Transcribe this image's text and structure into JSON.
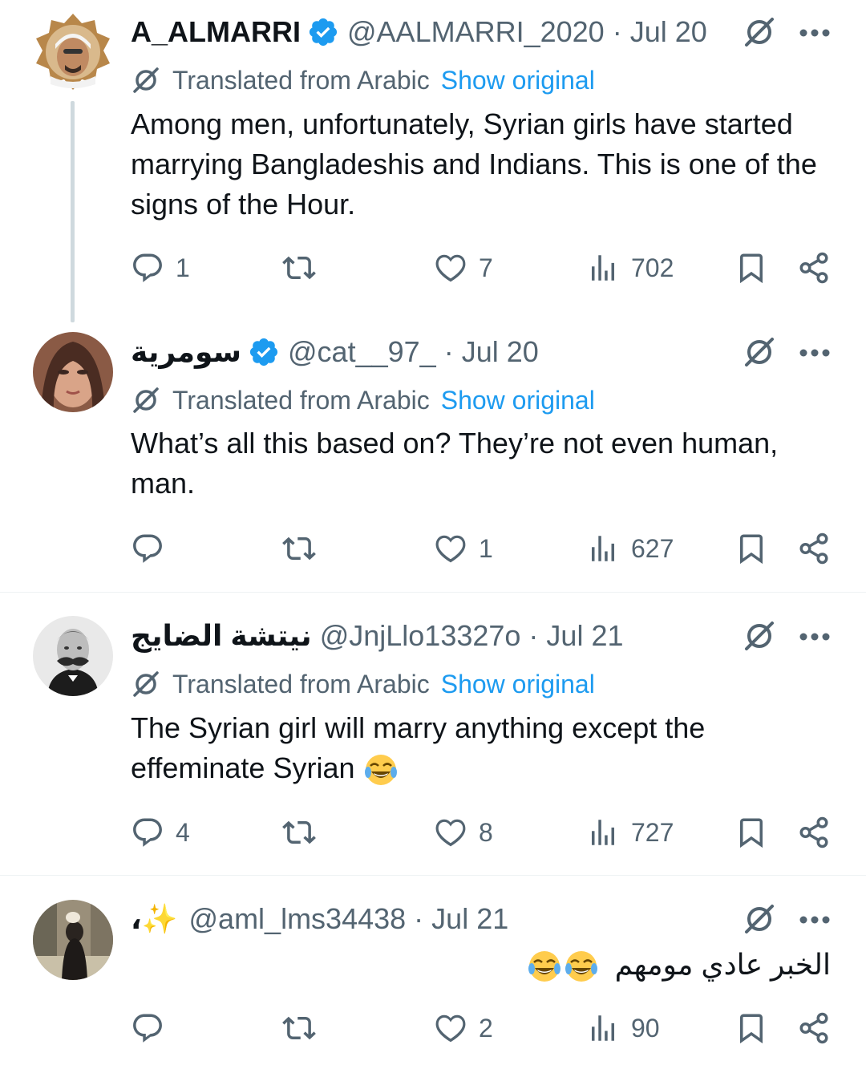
{
  "tweets": [
    {
      "name": "A_ALMARRI",
      "verified": true,
      "handle": "@AALMARRI_2020",
      "separator": "·",
      "date": "Jul 20",
      "translated_label": "Translated from Arabic",
      "show_original_label": "Show original",
      "text": "Among men, unfortunately, Syrian girls have started marrying Bangladeshis and Indians. This is one of the signs of the Hour.",
      "replies": "1",
      "reposts": "",
      "likes": "7",
      "views": "702"
    },
    {
      "name": "سومرية",
      "verified": true,
      "handle": "@cat__97_",
      "separator": "·",
      "date": "Jul 20",
      "translated_label": "Translated from Arabic",
      "show_original_label": "Show original",
      "text": "What’s all this based on? They’re not even human, man.",
      "replies": "",
      "reposts": "",
      "likes": "1",
      "views": "627"
    },
    {
      "name": "نيتشة الضايج",
      "verified": false,
      "handle": "@JnjLlo13327o",
      "separator": "·",
      "date": "Jul 21",
      "translated_label": "Translated from Arabic",
      "show_original_label": "Show original",
      "text": "The Syrian girl will marry anything except the effeminate Syrian",
      "emoji": "😂",
      "replies": "4",
      "reposts": "",
      "likes": "8",
      "views": "727"
    },
    {
      "name": "،✨",
      "verified": false,
      "handle": "@aml_lms34438",
      "separator": "·",
      "date": "Jul 21",
      "text": "الخبر عادي مومهم",
      "emoji": "😂😂",
      "replies": "",
      "reposts": "",
      "likes": "2",
      "views": "90"
    }
  ],
  "colors": {
    "accent": "#1d9bf0",
    "text": "#0f1419",
    "muted": "#536471",
    "divider": "#eff3f4",
    "thread_line": "#cfd9de"
  },
  "icons": [
    "reply-icon",
    "repost-icon",
    "like-icon",
    "views-icon",
    "bookmark-icon",
    "share-icon",
    "grok-icon",
    "more-icon",
    "translate-icon",
    "verified-icon",
    "face-with-tears-of-joy-emoji"
  ]
}
